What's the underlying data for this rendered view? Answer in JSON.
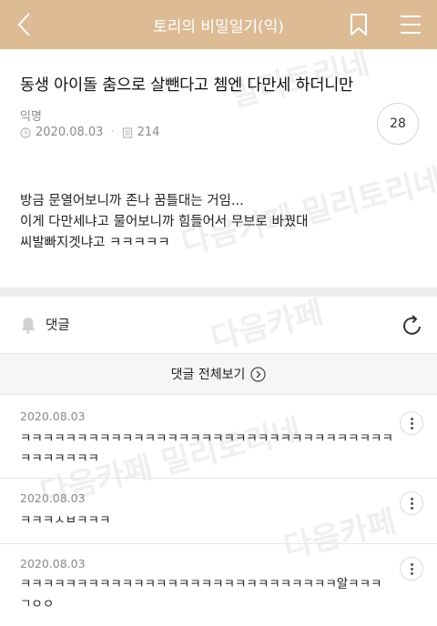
{
  "header": {
    "title": "토리의 비밀일기(익)"
  },
  "post": {
    "title": "동생 아이돌 춤으로 살뺀다고 쳄엔 다만세 하더니만",
    "author": "익명",
    "date": "2020.08.03",
    "views": "214",
    "comment_count": "28",
    "body_lines": [
      "방금 문열어보니까 존나 꿈틀대는 거임...",
      "이게 다만세냐고 물어보니까 힘들어서 무브로 바꿨대",
      "씨발빠지겟냐고 ㅋㅋㅋㅋㅋ"
    ]
  },
  "comments_section": {
    "label": "댓글",
    "view_all_label": "댓글 전체보기",
    "items": [
      {
        "date": "2020.08.03",
        "lines": [
          "ㅋㅋㅋㅋㅋㅋㅋㅋㅋㅋㅋㅋㅋㅋㅋㅋㅋㅋㅋㅋㅋㅋㅋㅋㅋㅋㅋㅋㅋㅋㅋㅋㅋ",
          "ㅋㅋㅋㅋㅋㅋㅋ"
        ]
      },
      {
        "date": "2020.08.03",
        "lines": [
          "ㅋㅋㅋㅅㅂㅋㅋㅋ"
        ]
      },
      {
        "date": "2020.08.03",
        "lines": [
          "ㅋㅋㅋㅋㅋㅋㅋㅋㅋㅋㅋㅋㅋㅋㅋㅋㅋㅋㅋㅋㅋㅋㅋㅋㅋㅋㅋㅋ알ㅋㅋㅋ",
          "ㄱㅇㅇ"
        ]
      }
    ]
  },
  "watermark": {
    "text_1": "다음카페",
    "text_2": "밀리토리네"
  },
  "colors": {
    "header_bg": "#dcbb95",
    "divider": "#eeeeee"
  }
}
